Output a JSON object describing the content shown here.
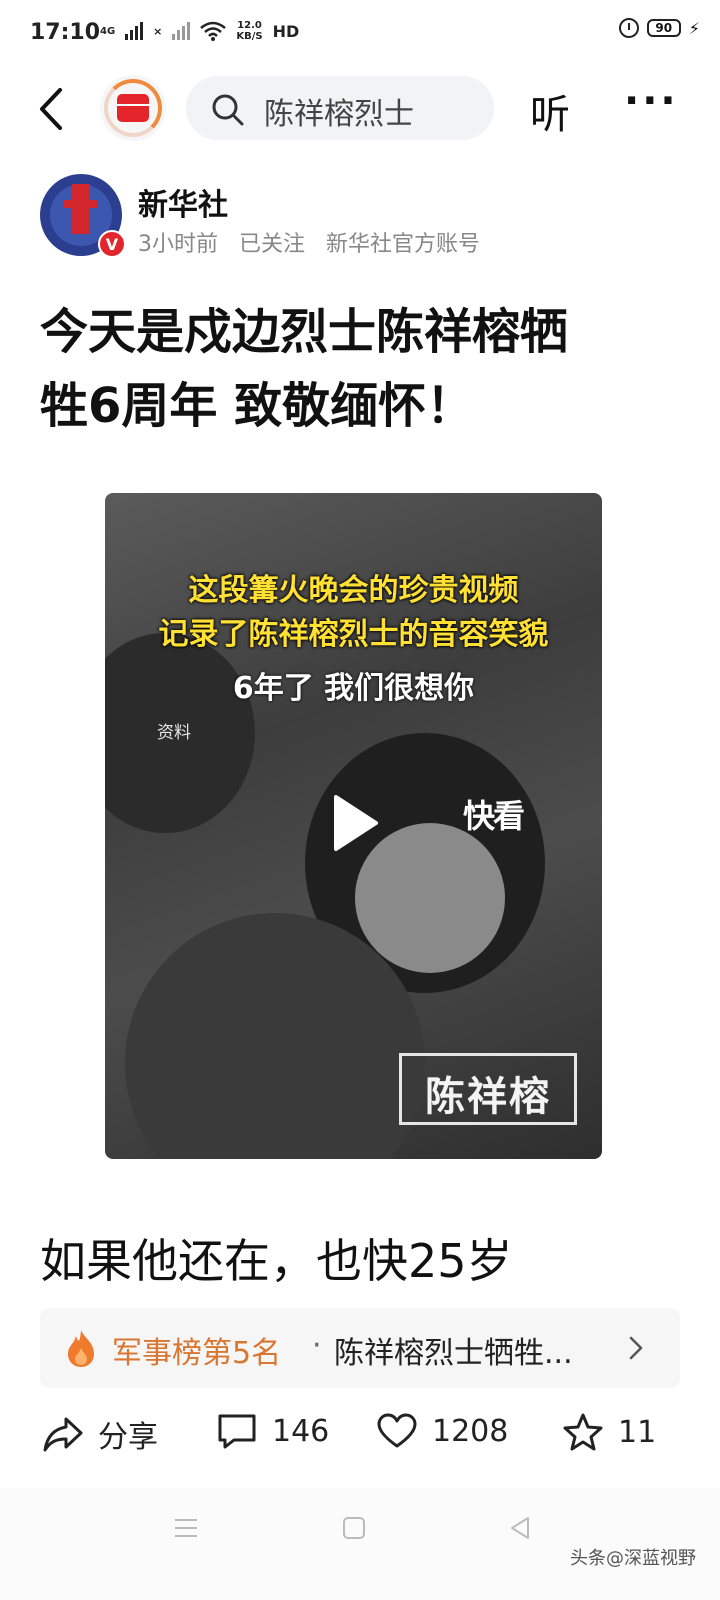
{
  "status_bar": {
    "time": "17:10",
    "network_1": "4G",
    "network_2": "×",
    "net_speed_value": "12.0",
    "net_speed_unit": "KB/S",
    "hd_label": "HD",
    "battery": "90"
  },
  "topbar": {
    "search_text": "陈祥榕烈士",
    "listen_label": "听",
    "more_label": "···"
  },
  "author": {
    "name": "新华社",
    "verified_badge": "V",
    "time_ago": "3小时前",
    "follow_status": "已关注",
    "account_desc": "新华社官方账号"
  },
  "article": {
    "headline_line1": "今天是戍边烈士陈祥榕牺",
    "headline_line2": "牲6周年 致敬缅怀！",
    "body_text": "如果他还在，也快25岁"
  },
  "video": {
    "overlay_line1": "这段篝火晚会的珍贵视频",
    "overlay_line2": "记录了陈祥榕烈士的音容笑貌",
    "overlay_line3": "6年了 我们很想你",
    "source_label": "资料",
    "logo_text": "快看",
    "name_label": "陈祥榕"
  },
  "hot_list": {
    "rank_text": "军事榜第5名",
    "separator": "·",
    "title": "陈祥榕烈士牺牲..."
  },
  "actions": {
    "share_label": "分享",
    "comment_count": "146",
    "like_count": "1208",
    "favorite_count": "11"
  },
  "watermark": "头条@深蓝视野",
  "colors": {
    "brand_red": "#e4262c",
    "hot_orange": "#d97731",
    "video_overlay_yellow": "#ffe033"
  }
}
